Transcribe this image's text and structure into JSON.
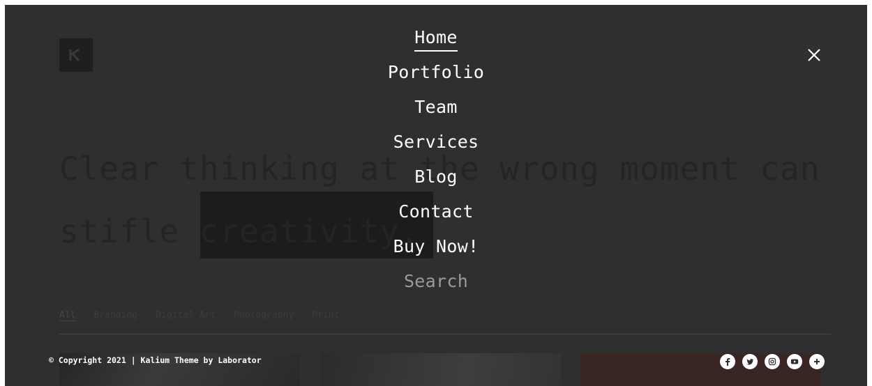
{
  "hero": {
    "line1": "Clear thinking at the wrong moment can",
    "line2_prefix": "stifle ",
    "line2_highlight": "creativity."
  },
  "filters": [
    "All",
    "Branding",
    "Digital Art",
    "Photography",
    "Print"
  ],
  "menu": {
    "items": [
      "Home",
      "Portfolio",
      "Team",
      "Services",
      "Blog",
      "Contact",
      "Buy Now!"
    ],
    "search_label": "Search"
  },
  "footer": {
    "copyright": "© Copyright 2021 | Kalium Theme by Laborator"
  },
  "socials": [
    "facebook-icon",
    "twitter-icon",
    "instagram-icon",
    "youtube-icon",
    "plus-icon"
  ],
  "colors": {
    "overlay_bg": "#2f2f2f",
    "menu_text": "#ffffff",
    "search_text": "#9a9a9a"
  }
}
